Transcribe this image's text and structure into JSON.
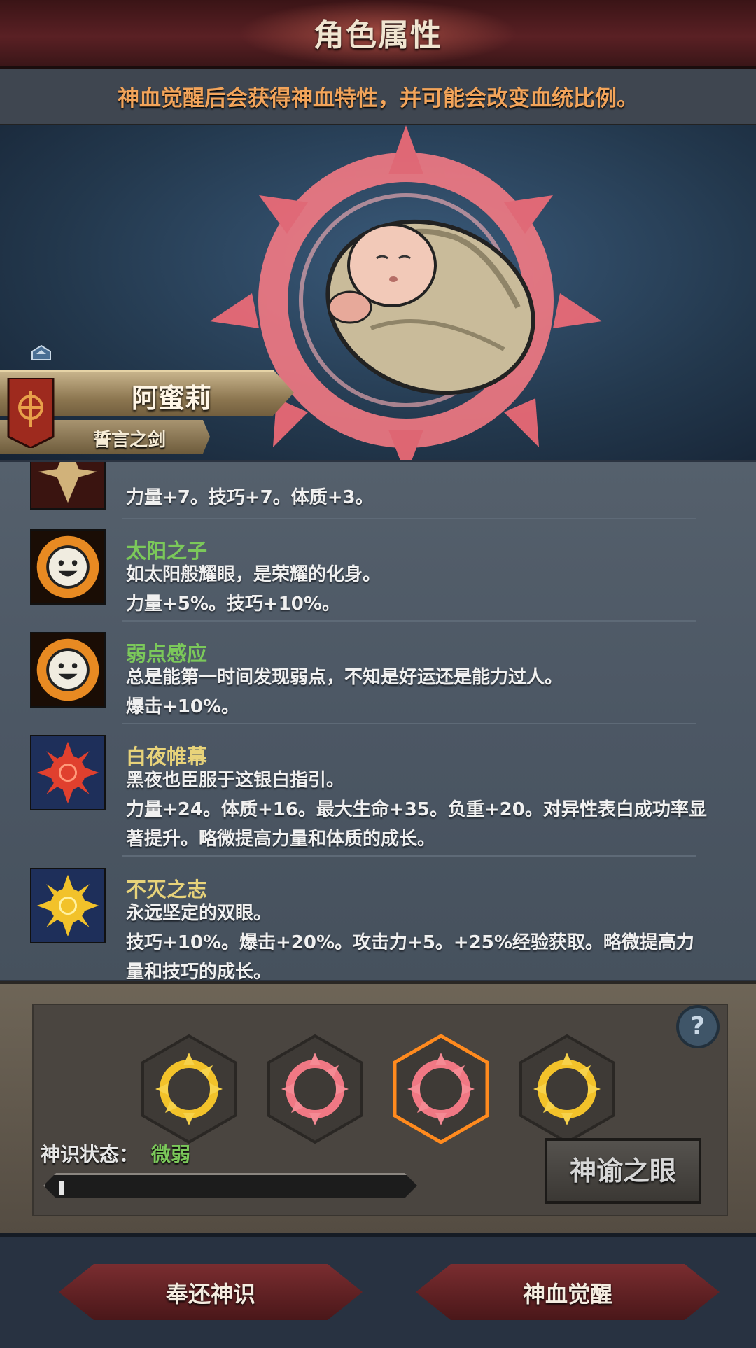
{
  "header": {
    "title": "角色属性"
  },
  "notice": {
    "text": "神血觉醒后会获得神血特性，并可能会改变血统比例。"
  },
  "hero": {
    "name": "阿蜜莉",
    "title": "誓言之剑"
  },
  "traits": [
    {
      "name": "",
      "desc": "",
      "stats": "力量+7。技巧+7。体质+3。",
      "name_color": "#7bc85a",
      "icon": "partial-trait-icon"
    },
    {
      "name": "太阳之子",
      "desc": "如太阳般耀眼，是荣耀的化身。",
      "stats": "力量+5%。技巧+10%。",
      "name_color": "#7bc85a",
      "icon": "smiley-sun-icon"
    },
    {
      "name": "弱点感应",
      "desc": "总是能第一时间发现弱点，不知是好运还是能力过人。",
      "stats": "爆击+10%。",
      "name_color": "#7bc85a",
      "icon": "smiley-sun-icon"
    },
    {
      "name": "白夜帷幕",
      "desc": "黑夜也臣服于这银白指引。",
      "stats": "力量+24。体质+16。最大生命+35。负重+20。对异性表白成功率显",
      "stats2": "著提升。略微提高力量和体质的成长。",
      "name_color": "#e8d37a",
      "icon": "red-sun-icon"
    },
    {
      "name": "不灭之志",
      "desc": "永远坚定的双眼。",
      "stats": "技巧+10%。爆击+20%。攻击力+5。+25%经验获取。略微提高力",
      "stats2": "量和技巧的成长。",
      "name_color": "#e8d37a",
      "icon": "gold-sun-icon"
    }
  ],
  "awakening": {
    "status_label": "神识状态：",
    "status_value": "微弱",
    "progress": 0.01,
    "oracle_button": "神谕之眼",
    "sigils": [
      "gold-sigil-icon",
      "red-sigil-icon",
      "red-sigil-selected-icon",
      "gold-sigil-icon"
    ]
  },
  "footer": {
    "return_label": "奉还神识",
    "awaken_label": "神血觉醒"
  },
  "colors": {
    "accent_green": "#7bc85a",
    "accent_gold": "#e8d37a",
    "notice_orange": "#f2a45a"
  }
}
